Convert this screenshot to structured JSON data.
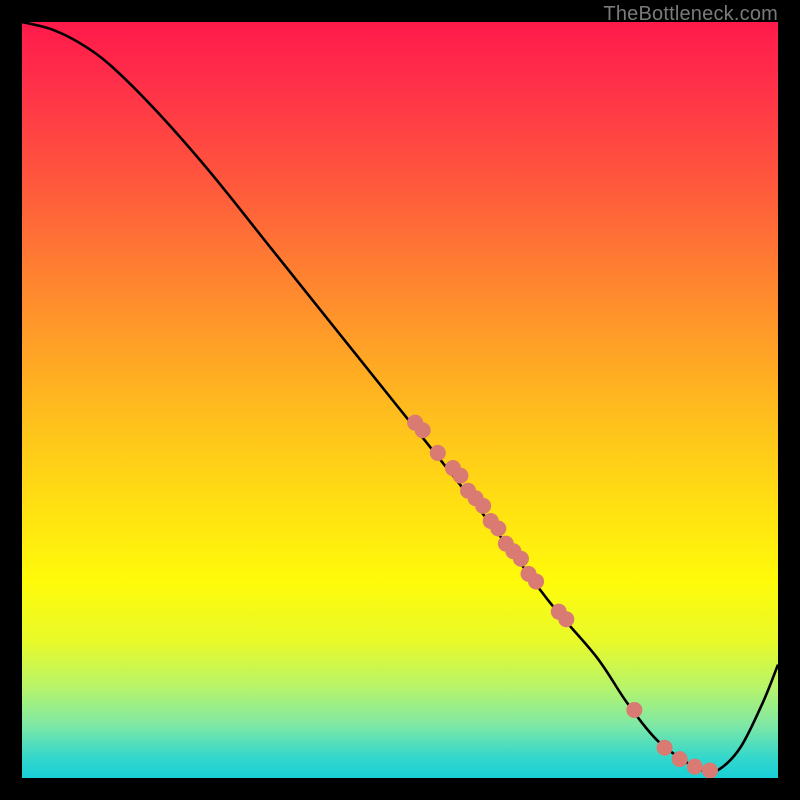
{
  "chart_data": {
    "type": "line",
    "watermark": "TheBottleneck.com",
    "title": "",
    "xlabel": "",
    "ylabel": "",
    "xlim": [
      0,
      100
    ],
    "ylim": [
      0,
      100
    ],
    "axes_visible": false,
    "grid": false,
    "background_gradient": {
      "direction": "top-to-bottom",
      "stops": [
        {
          "pos": 0.0,
          "color": "#ff1a4b"
        },
        {
          "pos": 0.5,
          "color": "#ffe012"
        },
        {
          "pos": 0.97,
          "color": "#38d8c9"
        },
        {
          "pos": 1.0,
          "color": "#18cfd8"
        }
      ],
      "meaning": "red=high-bottleneck, green=low-bottleneck"
    },
    "series": [
      {
        "name": "bottleneck_curve",
        "style": "line",
        "color": "#000000",
        "x": [
          0,
          4,
          8,
          12,
          18,
          25,
          33,
          41,
          49,
          57,
          64,
          70,
          76,
          80,
          84,
          88,
          90,
          92,
          95,
          98,
          100
        ],
        "y": [
          100,
          99,
          97,
          94,
          88,
          80,
          70,
          60,
          50,
          40,
          31,
          23,
          16,
          10,
          5,
          2,
          1,
          1,
          4,
          10,
          15
        ],
        "note": "x is normalized hardware-balance axis, y is bottleneck percentage"
      },
      {
        "name": "sample_points",
        "style": "scatter",
        "color": "#d97a73",
        "radius": 8,
        "points": [
          {
            "x": 52,
            "y": 47
          },
          {
            "x": 53,
            "y": 46
          },
          {
            "x": 55,
            "y": 43
          },
          {
            "x": 57,
            "y": 41
          },
          {
            "x": 58,
            "y": 40
          },
          {
            "x": 59,
            "y": 38
          },
          {
            "x": 60,
            "y": 37
          },
          {
            "x": 61,
            "y": 36
          },
          {
            "x": 62,
            "y": 34
          },
          {
            "x": 63,
            "y": 33
          },
          {
            "x": 64,
            "y": 31
          },
          {
            "x": 65,
            "y": 30
          },
          {
            "x": 66,
            "y": 29
          },
          {
            "x": 67,
            "y": 27
          },
          {
            "x": 68,
            "y": 26
          },
          {
            "x": 71,
            "y": 22
          },
          {
            "x": 72,
            "y": 21
          },
          {
            "x": 81,
            "y": 9
          },
          {
            "x": 85,
            "y": 4
          },
          {
            "x": 87,
            "y": 2.5
          },
          {
            "x": 89,
            "y": 1.5
          },
          {
            "x": 91,
            "y": 1
          }
        ]
      }
    ]
  }
}
